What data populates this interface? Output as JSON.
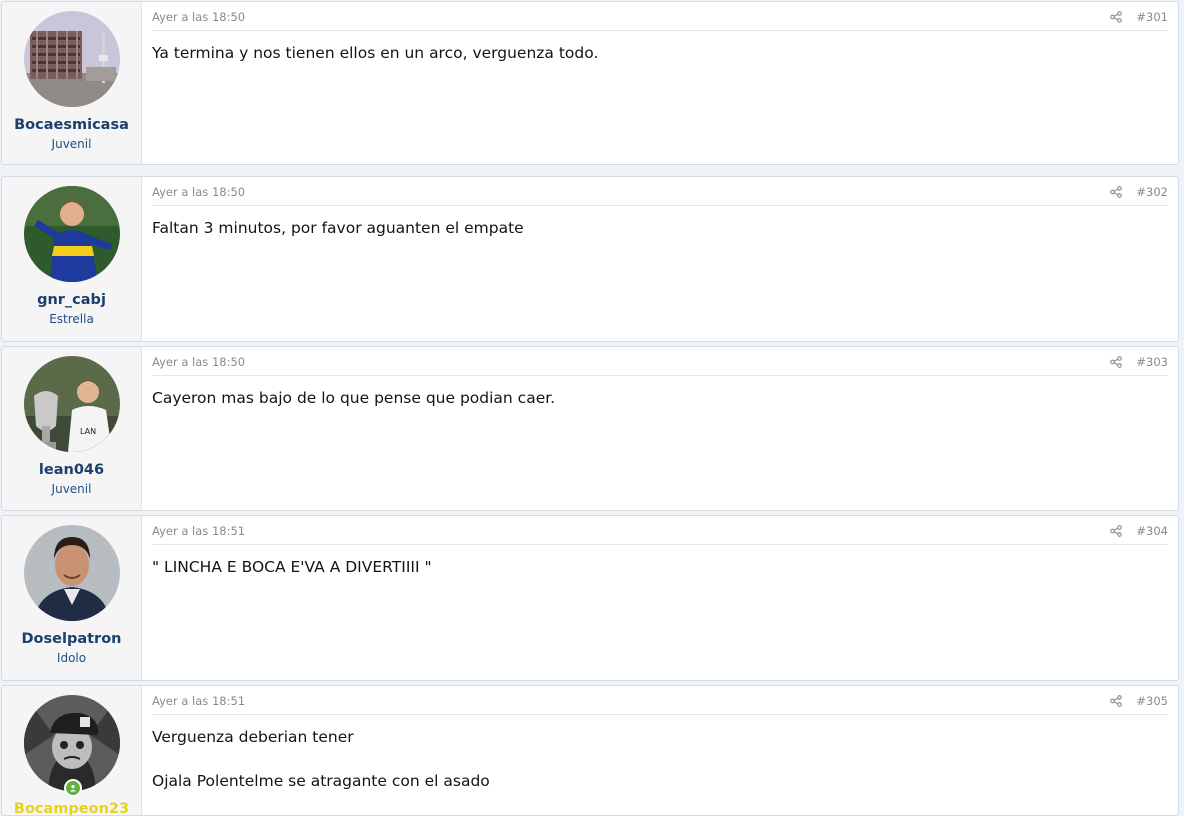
{
  "posts": [
    {
      "username": "Bocaesmicasa",
      "user_title": "Juvenil",
      "date": "Ayer a las 18:50",
      "number": "#301",
      "avatar_icon": "stadium-avatar-icon",
      "body": [
        "Ya termina y nos tienen ellos en un arco, verguenza todo."
      ]
    },
    {
      "username": "gnr_cabj",
      "user_title": "Estrella",
      "date": "Ayer a las 18:50",
      "number": "#302",
      "avatar_icon": "player-avatar-icon",
      "body": [
        "Faltan 3 minutos, por favor aguanten el empate"
      ]
    },
    {
      "username": "lean046",
      "user_title": "Juvenil",
      "date": "Ayer a las 18:50",
      "number": "#303",
      "avatar_icon": "trophy-avatar-icon",
      "body": [
        "Cayeron mas bajo de lo que pense que podian caer."
      ]
    },
    {
      "username": "Doselpatron",
      "user_title": "Idolo",
      "date": "Ayer a las 18:51",
      "number": "#304",
      "avatar_icon": "coach-avatar-icon",
      "body": [
        "\" LINCHA E BOCA E'VA A DIVERTIIII \""
      ]
    },
    {
      "username": "Bocampeon23",
      "user_title": "",
      "date": "Ayer a las 18:51",
      "number": "#305",
      "avatar_icon": "fan-avatar-icon",
      "online_icon": "online-user-icon",
      "body": [
        "Verguenza deberian tener",
        "Ojala Polentelme se atragante con el asado"
      ]
    }
  ],
  "colors": {
    "username": "#1c3f6e",
    "username_highlight": "#e7d319",
    "user_title": "#1e4f8a",
    "online": "#63b141"
  },
  "icons": {
    "share": "share-icon"
  }
}
